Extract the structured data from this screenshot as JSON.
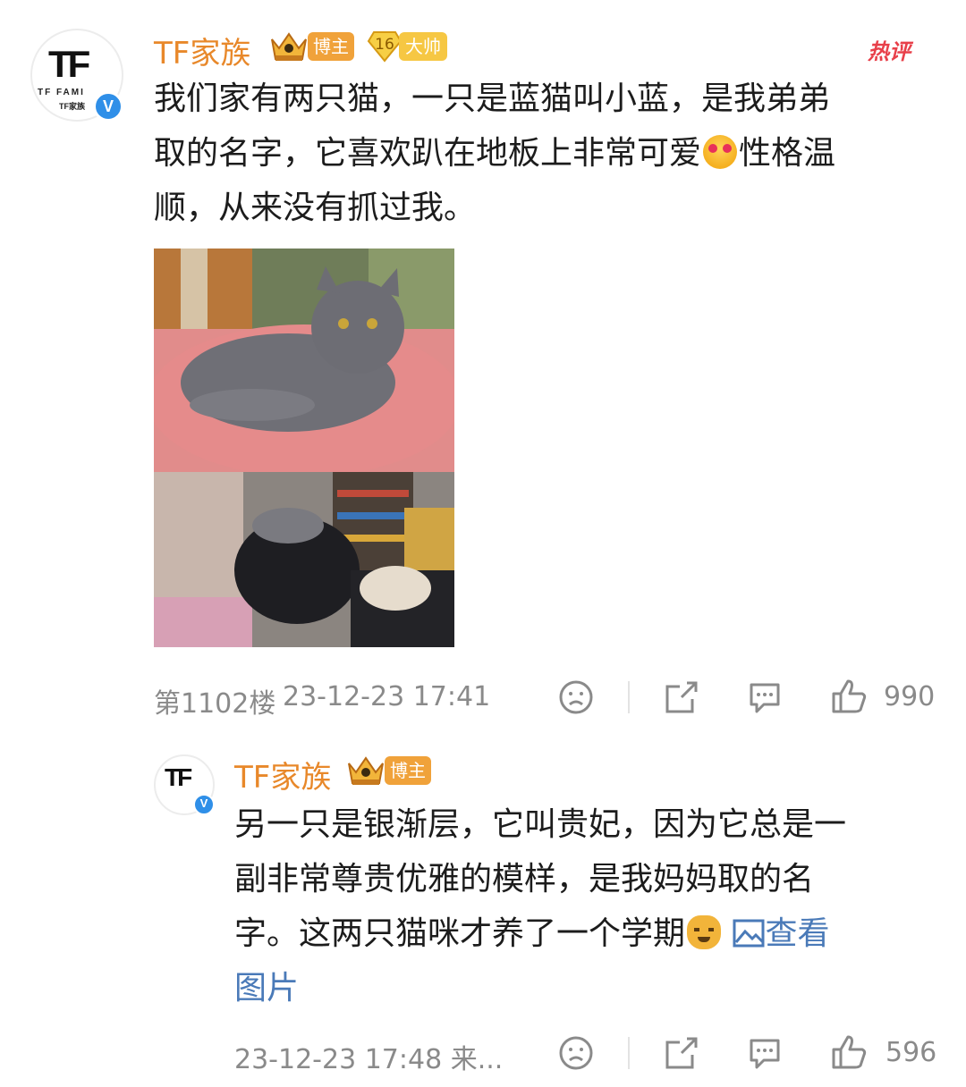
{
  "comment": {
    "avatar_text": "TF",
    "avatar_small": "TF FAMI",
    "avatar_small2": "TF家族",
    "username": "TF家族",
    "badge_blogger": "博主",
    "badge_level": "16",
    "badge_master": "大帅",
    "hot_label": "热评",
    "content_line1": "我们家有两只猫，一只是蓝猫叫小蓝，是我弟弟",
    "content_line2a": "取的名字，它喜欢趴在地板上非常可爱",
    "content_line2b": "性格温",
    "content_line3": "顺，从来没有抓过我。",
    "floor": "第1102楼",
    "time": "23-12-23 17:41",
    "like_count": "990"
  },
  "reply": {
    "avatar_text": "TF",
    "username": "TF家族",
    "badge_blogger": "博主",
    "content_line1": "另一只是银渐层，它叫贵妃，因为它总是一",
    "content_line2": "副非常尊贵优雅的模样，是我妈妈取的名",
    "content_line3a": "字。这两只猫咪才养了一个学期",
    "view_pic_label": "查看",
    "content_line4": "图片",
    "time": "23-12-23 17:48 来...",
    "like_count": "596"
  }
}
